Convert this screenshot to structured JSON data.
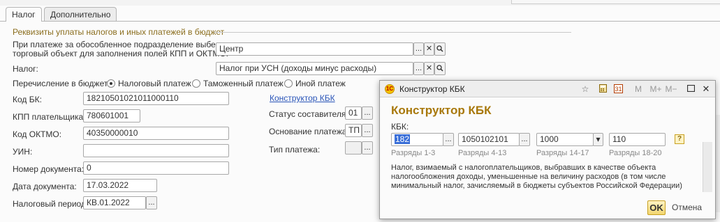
{
  "tabs": [
    {
      "label": "Налог"
    },
    {
      "label": "Дополнительно"
    }
  ],
  "group_title": "Реквизиты уплаты налогов и иных платежей в бюджет",
  "subdivision": {
    "label_line1": "При платеже за обособленное подразделение выберите",
    "label_line2": "торговый объект для заполнения полей КПП и ОКТМО:",
    "value": "Центр"
  },
  "tax": {
    "label": "Налог:",
    "value": "Налог при УСН (доходы минус расходы)"
  },
  "transfer": {
    "label": "Перечисление в бюджет:",
    "options": [
      "Налоговый платеж",
      "Таможенный платеж",
      "Иной платеж"
    ],
    "selected": "Налоговый платеж"
  },
  "fields": {
    "kbk": {
      "label": "Код БК:",
      "value": "18210501021011000110"
    },
    "kpp": {
      "label": "КПП плательщика:",
      "value": "780601001"
    },
    "oktmo": {
      "label": "Код ОКТМО:",
      "value": "40350000010"
    },
    "uin": {
      "label": "УИН:",
      "value": ""
    },
    "doc_number": {
      "label": "Номер документа:",
      "value": "0"
    },
    "doc_date": {
      "label": "Дата документа:",
      "value": "17.03.2022"
    },
    "tax_period": {
      "label": "Налоговый период:",
      "value": "КВ.01.2022"
    }
  },
  "kbk_constructor_link": "Конструктор КБК",
  "right_fields": {
    "status": {
      "label": "Статус составителя:",
      "value": "01"
    },
    "basis": {
      "label": "Основание платежа:",
      "value": "ТП"
    },
    "payment_type": {
      "label": "Тип платежа:",
      "value": ""
    }
  },
  "dialog": {
    "title": "Конструктор КБК",
    "heading": "Конструктор КБК",
    "kbk_label": "КБК:",
    "segments": [
      {
        "value": "182",
        "caption": "Разряды 1-3"
      },
      {
        "value": "1050102101",
        "caption": "Разряды 4-13"
      },
      {
        "value": "1000",
        "caption": "Разряды 14-17"
      },
      {
        "value": "110",
        "caption": "Разряды 18-20"
      }
    ],
    "description_lines": [
      "Налог, взимаемый с налогоплательщиков, выбравших в качестве объекта",
      "налогообложения доходы, уменьшенные на величину расходов (в том числе",
      "минимальный налог, зачисляемый в бюджеты субъектов Российской Федерации)"
    ],
    "ok_label": "OK",
    "cancel_label": "Отмена",
    "titlebar_icons": [
      "star-icon",
      "calculator-icon",
      "calendar-icon",
      "memory-m-icon",
      "memory-plus-icon",
      "memory-minus-icon",
      "maximize-icon",
      "close-icon"
    ],
    "titlebar_glyphs": {
      "m": "M",
      "mplus": "M+",
      "mminus": "M−",
      "calendar": "31"
    },
    "help_glyph": "?"
  },
  "glyphs": {
    "ellipsis": "...",
    "clear": "✕",
    "search": "🔍",
    "dropdown": "▾"
  },
  "colors": {
    "accent_heading": "#a8780b",
    "group_title": "#8a6d1d",
    "link": "#2a55b8",
    "selection": "#3a6fd8"
  }
}
